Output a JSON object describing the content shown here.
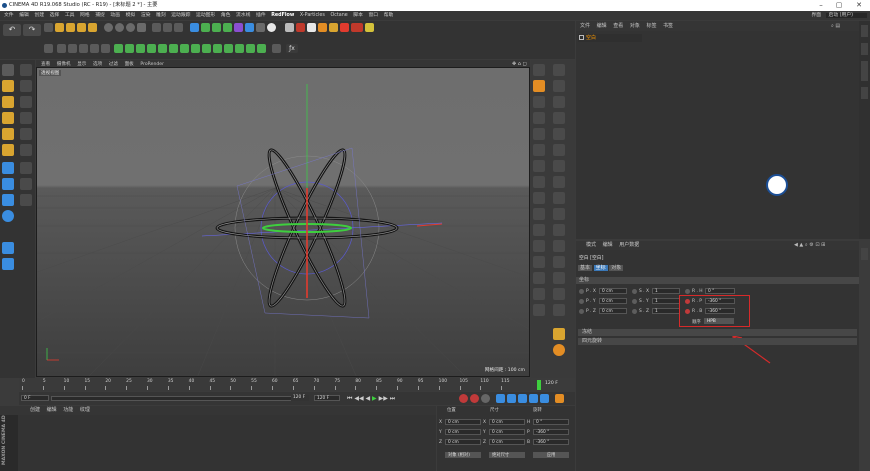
{
  "window": {
    "title": "CINEMA 4D R19.068 Studio (RC - R19) - [未标题 2 *] - 主要",
    "layout_label": "界面",
    "layout_value": "启动 (用户)"
  },
  "menu": {
    "items": [
      "文件",
      "编辑",
      "创建",
      "选择",
      "工具",
      "网格",
      "捕捉",
      "动画",
      "模拟",
      "渲染",
      "雕刻",
      "运动跟踪",
      "运动图形",
      "角色",
      "流水线",
      "插件",
      "RedFlow",
      "X-Particles",
      "Octane",
      "脚本",
      "窗口",
      "帮助"
    ]
  },
  "viewport": {
    "menu": [
      "查看",
      "摄像机",
      "显示",
      "选项",
      "过滤",
      "面板",
      "ProRender"
    ],
    "camera_label": "透视视图",
    "grid_label": "网格间距 : 100 cm"
  },
  "objects": {
    "tabs": [
      "文件",
      "编辑",
      "查看",
      "对象",
      "标签",
      "书签"
    ],
    "null_name": "空白"
  },
  "attributes": {
    "tabs": [
      "模式",
      "编辑",
      "用户数据"
    ],
    "title": "空白 [空白]",
    "subtabs": [
      "基本",
      "坐标",
      "对象"
    ],
    "section_label": "坐标",
    "rows": [
      {
        "p_label": "P . X",
        "p_value": "0 cm",
        "s_label": "S . X",
        "s_value": "1",
        "r_label": "R . H",
        "r_value": "0 °"
      },
      {
        "p_label": "P . Y",
        "p_value": "0 cm",
        "s_label": "S . Y",
        "s_value": "1",
        "r_label": "R . P",
        "r_value": "-360 °"
      },
      {
        "p_label": "P . Z",
        "p_value": "0 cm",
        "s_label": "S . Z",
        "s_value": "1",
        "r_label": "R . B",
        "r_value": "-360 °"
      }
    ],
    "order_label": "顺序",
    "order_value": "HPB",
    "freeze": "冻结",
    "quaternion": "四元旋转"
  },
  "timeline": {
    "ticks": [
      "0",
      "5",
      "10",
      "15",
      "20",
      "25",
      "30",
      "35",
      "40",
      "45",
      "50",
      "55",
      "60",
      "65",
      "70",
      "75",
      "80",
      "85",
      "90",
      "95",
      "100",
      "105",
      "110",
      "115"
    ],
    "current_frame": "0 F",
    "end_display": "120 F",
    "start_field": "0 F",
    "end_field": "120 F",
    "max_field": "120 F"
  },
  "materials": {
    "tabs": [
      "创建",
      "编辑",
      "功能",
      "纹理"
    ]
  },
  "coords": {
    "headers": [
      "位置",
      "尺寸",
      "旋转"
    ],
    "rows": [
      {
        "axis": "X",
        "pos": "0 cm",
        "size": "0 cm",
        "rot_label": "H",
        "rot": "0 °"
      },
      {
        "axis": "Y",
        "pos": "0 cm",
        "size": "0 cm",
        "rot_label": "P",
        "rot": "-360 °"
      },
      {
        "axis": "Z",
        "pos": "0 cm",
        "size": "0 cm",
        "rot_label": "B",
        "rot": "-360 °"
      }
    ],
    "mode_object": "对象 (相对)",
    "mode_size": "绝对尺寸",
    "apply": "应用"
  },
  "branding": {
    "line1": "MAXON",
    "line2": "CINEMA 4D"
  },
  "colors": {
    "highlight_red": "#d62a2a",
    "green_ring": "#3ecf3e",
    "axis_red": "#e23b2e",
    "axis_green": "#3ec94a",
    "accent_orange": "#e38d24"
  }
}
